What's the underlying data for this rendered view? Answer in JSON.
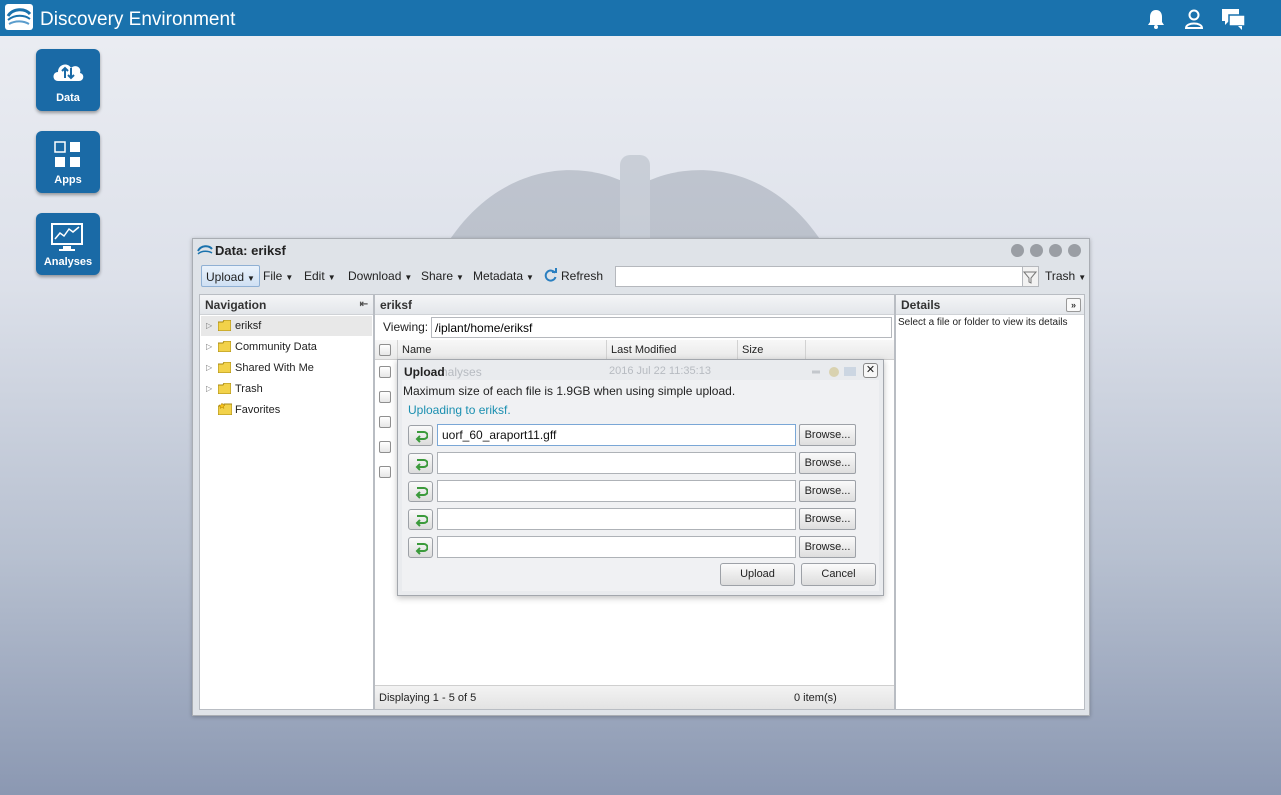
{
  "app": {
    "title": "Discovery Environment",
    "accent_color": "#1a72ad"
  },
  "topbar_icons": [
    "bell-icon",
    "user-icon",
    "chat-icon"
  ],
  "launcher": [
    {
      "label": "Data",
      "icon": "cloud-upload-download-icon"
    },
    {
      "label": "Apps",
      "icon": "apps-grid-icon"
    },
    {
      "label": "Analyses",
      "icon": "monitor-chart-icon"
    }
  ],
  "window": {
    "title": "Data: eriksf",
    "toolbar": {
      "upload": "Upload",
      "file": "File",
      "edit": "Edit",
      "download": "Download",
      "share": "Share",
      "metadata": "Metadata",
      "refresh": "Refresh",
      "search_value": "",
      "trash": "Trash"
    },
    "navigation": {
      "header": "Navigation",
      "items": [
        {
          "label": "eriksf",
          "selected": true
        },
        {
          "label": "Community Data",
          "selected": false
        },
        {
          "label": "Shared With Me",
          "selected": false
        },
        {
          "label": "Trash",
          "selected": false
        },
        {
          "label": "Favorites",
          "selected": false
        }
      ]
    },
    "center": {
      "header": "eriksf",
      "viewing_label": "Viewing:",
      "viewing_path": "/iplant/home/eriksf",
      "columns": [
        "Name",
        "Last Modified",
        "Size"
      ],
      "footer_left": "Displaying 1 - 5 of 5",
      "footer_right": "0 item(s)"
    },
    "details": {
      "header": "Details",
      "hint": "Select a file or folder to view its details"
    }
  },
  "upload_dialog": {
    "title": "Upload",
    "ghost_name_text": "nalyses",
    "ghost_date_text": "2016 Jul 22 11:35:13",
    "message": "Maximum size of each file is 1.9GB when using simple upload.",
    "destination": "Uploading to eriksf.",
    "files": [
      {
        "value": "uorf_60_araport11.gff",
        "browse": "Browse..."
      },
      {
        "value": "",
        "browse": "Browse..."
      },
      {
        "value": "",
        "browse": "Browse..."
      },
      {
        "value": "",
        "browse": "Browse..."
      },
      {
        "value": "",
        "browse": "Browse..."
      }
    ],
    "upload_button": "Upload",
    "cancel_button": "Cancel",
    "destination_color": "#1a8fb0"
  }
}
